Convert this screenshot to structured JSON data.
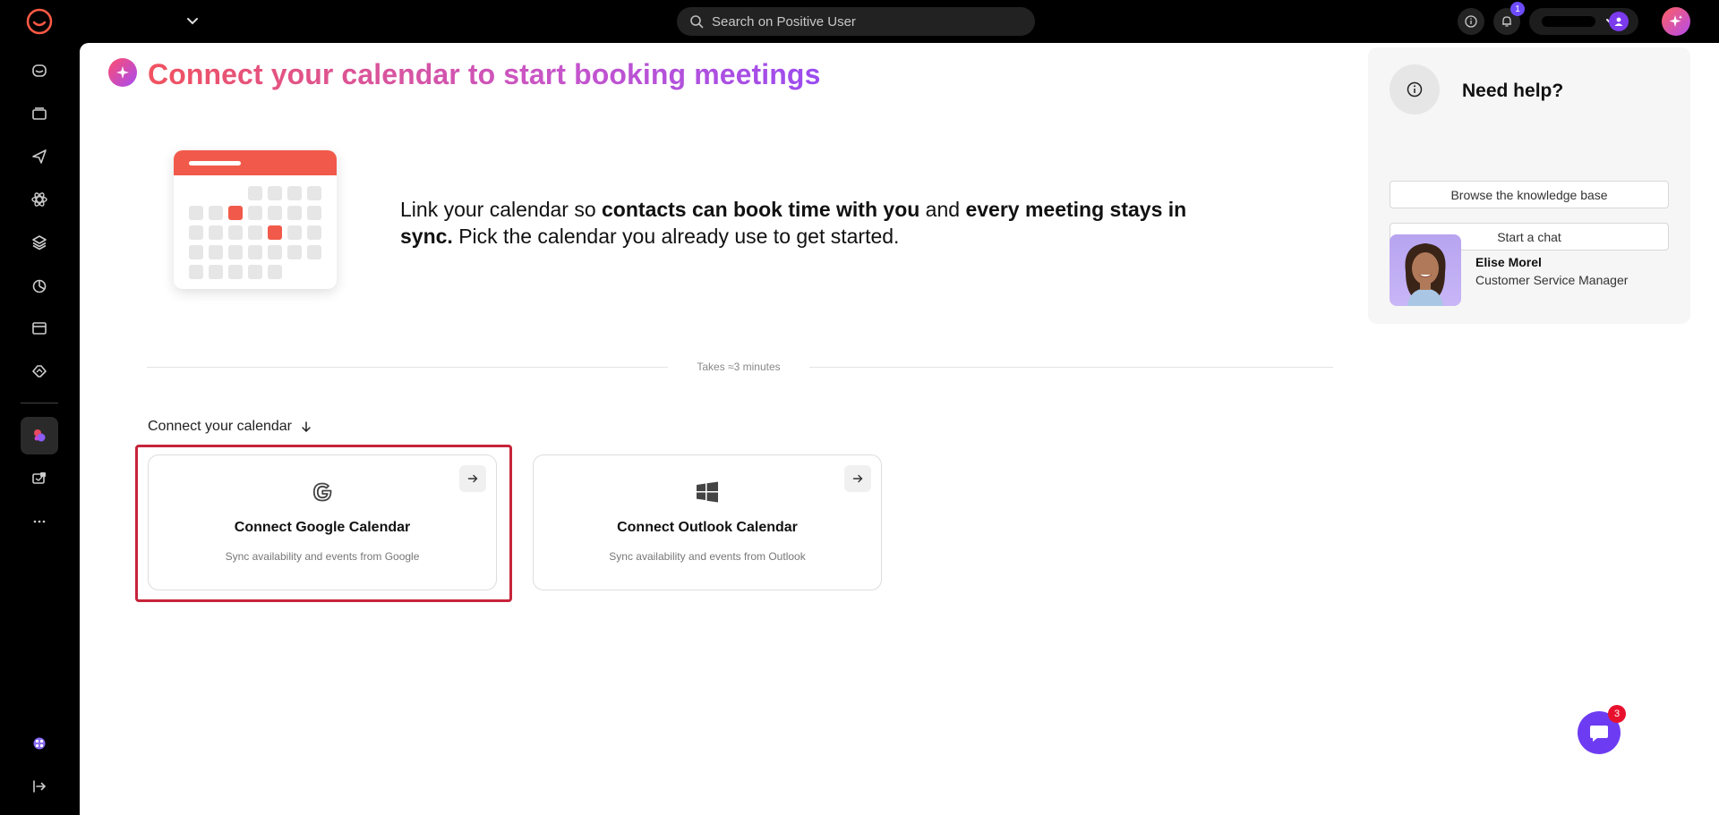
{
  "topbar": {
    "search_placeholder": "Search on Positive User",
    "notifications_count": "1"
  },
  "main": {
    "page_title": "Connect your calendar to start booking meetings",
    "intro": {
      "part1": "Link your calendar so ",
      "bold1": "contacts can book time with you",
      "part2": " and ",
      "bold2": "every meeting stays in sync.",
      "part3": " Pick the calendar you already use to get started."
    },
    "duration_note": "Takes ≈3 minutes",
    "section_label": "Connect your calendar",
    "cards": {
      "google": {
        "title": "Connect Google Calendar",
        "subtitle": "Sync availability and events from Google"
      },
      "outlook": {
        "title": "Connect Outlook Calendar",
        "subtitle": "Sync availability and events from Outlook"
      }
    }
  },
  "help": {
    "title": "Need help?",
    "knowledge_base_label": "Browse the knowledge base",
    "chat_label": "Start a chat",
    "agent_name": "Elise Morel",
    "agent_role": "Customer Service Manager"
  },
  "chat_widget": {
    "unread_count": "3"
  },
  "colors": {
    "accent_purple": "#6d3cf2",
    "title_gradient_start": "#f0525f",
    "title_gradient_end": "#9b4cf0",
    "calendar_red": "#f15a4a",
    "focus_red": "#c7243a"
  }
}
